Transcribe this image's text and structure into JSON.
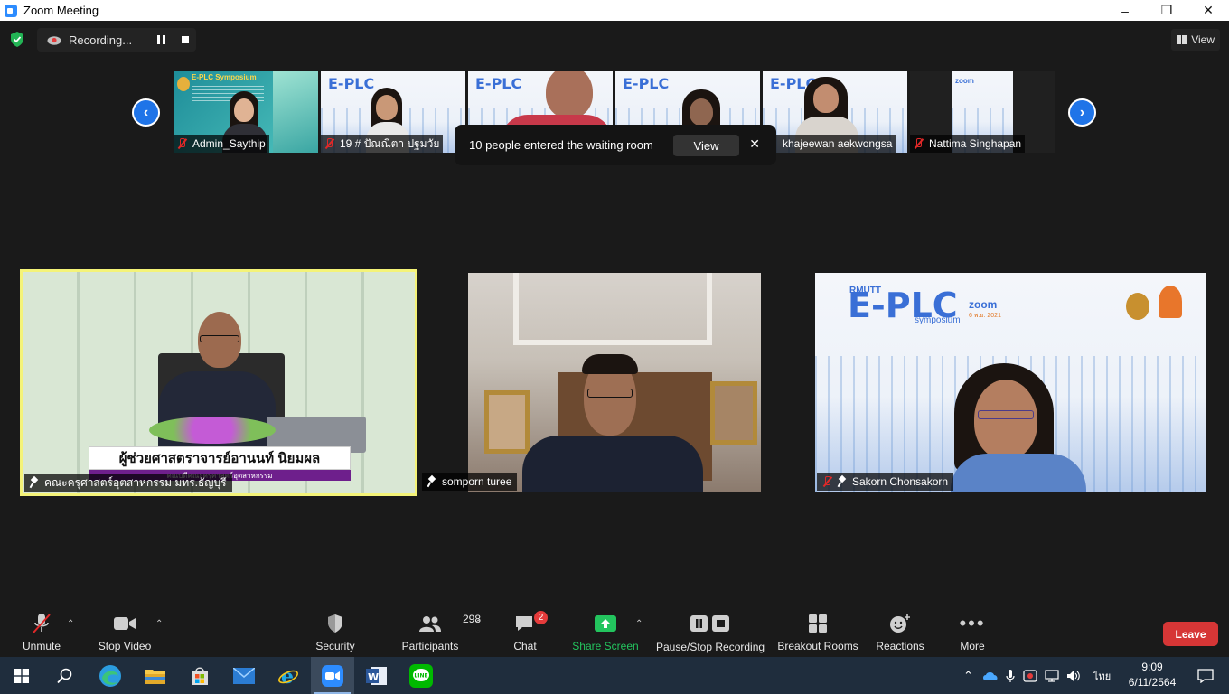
{
  "window": {
    "title": "Zoom Meeting",
    "controls": [
      "–",
      "❐",
      "✕"
    ]
  },
  "topbar": {
    "recording_label": "Recording...",
    "view_label": "View"
  },
  "thumbnails": [
    {
      "name": "Admin_Saythip",
      "muted": true
    },
    {
      "name": "19 # ปัณณิตา ปฐมวัย",
      "muted": true
    },
    {
      "name": "",
      "muted": false
    },
    {
      "name": "",
      "muted": false
    },
    {
      "name": "khajeewan aekwongsa",
      "muted": false
    },
    {
      "name": "Nattima Singhapan",
      "muted": true
    }
  ],
  "thumb_banner": {
    "brand": "E-PLC",
    "prefix": "RMUTT",
    "sub": "symposium",
    "zoom": "zoom",
    "admin_title": "E-PLC Symposium"
  },
  "toast": {
    "message": "10 people entered the waiting room",
    "view_button": "View",
    "close": "✕"
  },
  "tiles": [
    {
      "name": "คณะครุศาสตร์อุตสาหกรรม มทร.ธัญบุรี",
      "caption": "ผู้ช่วยศาสตราจารย์อานนท์ นิยมผล",
      "caption_sub": "คณบดีคณะครุศาสตร์อุตสาหกรรม",
      "muted": false
    },
    {
      "name": "somporn turee",
      "muted": false
    },
    {
      "name": "Sakorn  Chonsakorn",
      "muted": true,
      "banner_brand": "E-PLC",
      "banner_prefix": "RMUTT",
      "banner_sub": "symposium",
      "banner_zoom": "zoom",
      "banner_date": "6 พ.ย. 2021"
    }
  ],
  "toolbar": {
    "unmute": "Unmute",
    "stop_video": "Stop Video",
    "security": "Security",
    "participants": "Participants",
    "participants_count": "298",
    "chat": "Chat",
    "chat_badge": "2",
    "share_screen": "Share Screen",
    "pause_stop_recording": "Pause/Stop Recording",
    "breakout_rooms": "Breakout Rooms",
    "reactions": "Reactions",
    "more": "More",
    "leave": "Leave"
  },
  "taskbar": {
    "apps": [
      "start",
      "search",
      "edge",
      "file-explorer",
      "store",
      "mail",
      "internet-explorer",
      "zoom",
      "word",
      "line"
    ],
    "language": "ไทย",
    "time": "9:09",
    "date": "6/11/2564",
    "line_label": "LINE"
  },
  "colors": {
    "accent_blue": "#2d8cff",
    "leave_red": "#d63636",
    "share_green": "#23c45e",
    "active_speaker": "#f4f378"
  }
}
